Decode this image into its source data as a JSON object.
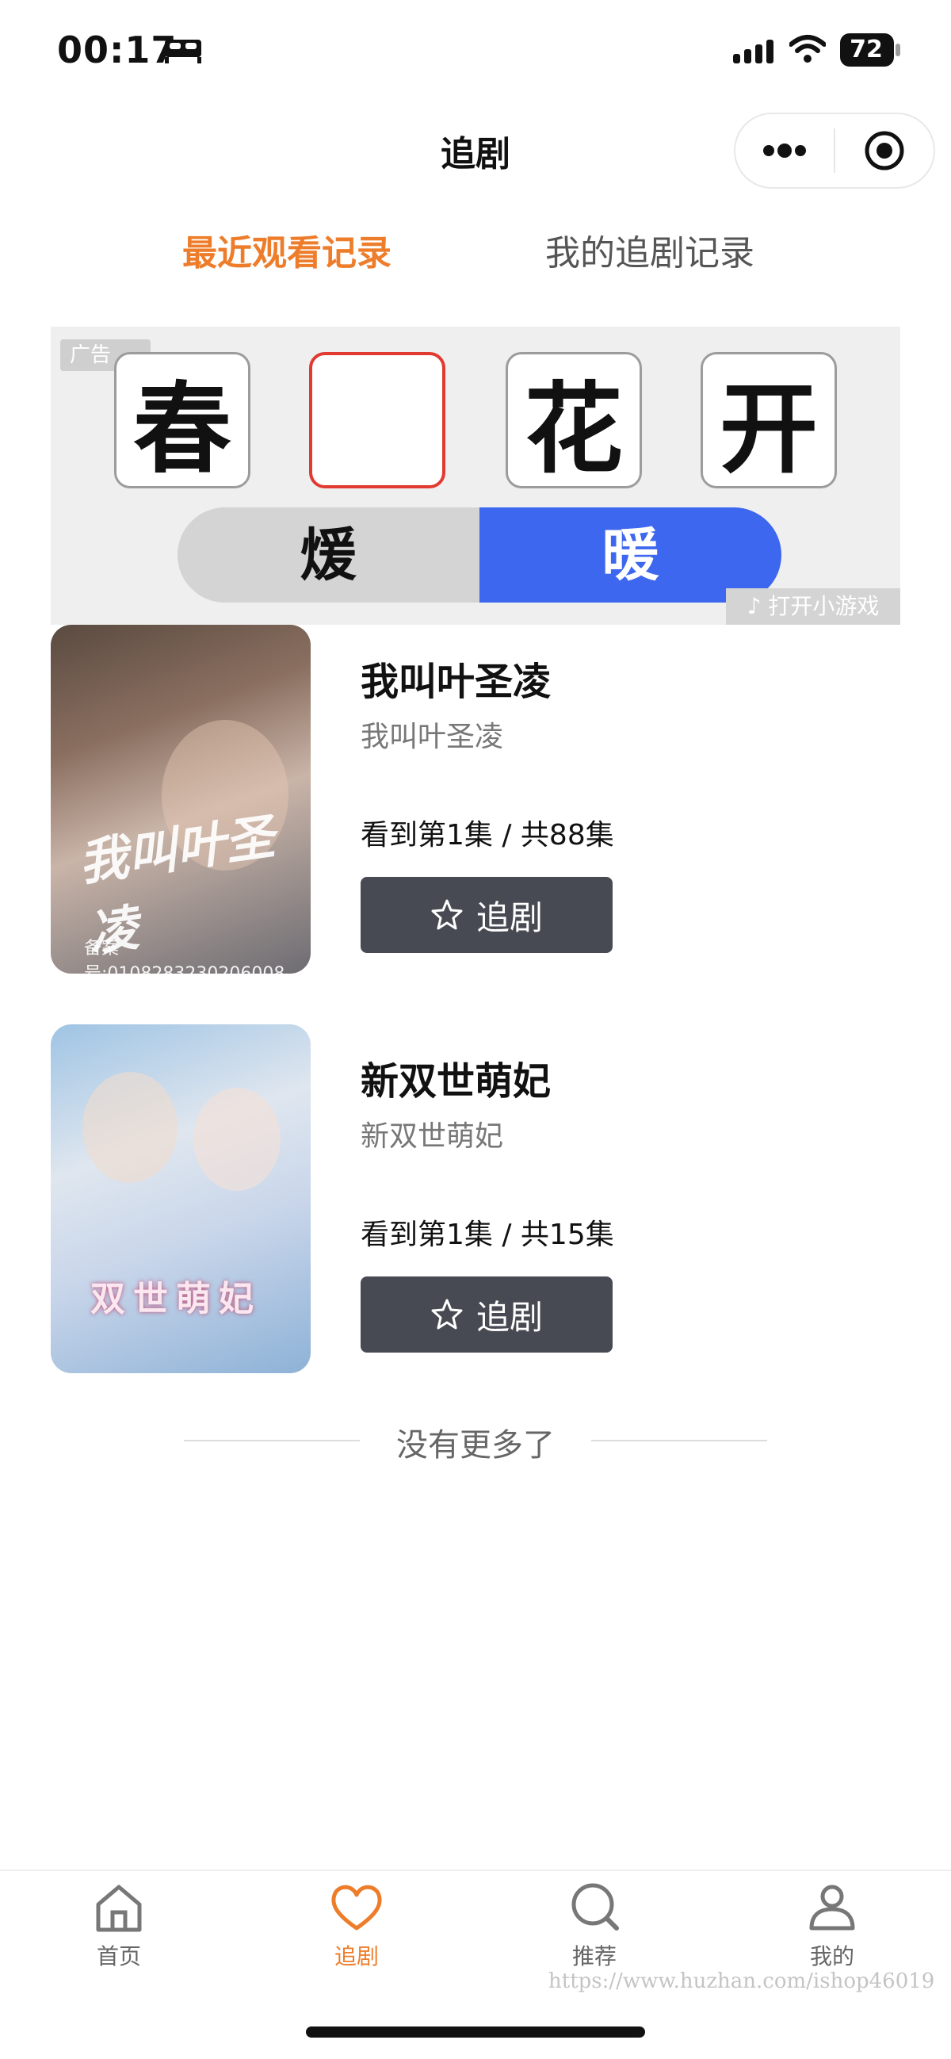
{
  "status_bar": {
    "time": "00:17",
    "battery": "72"
  },
  "nav": {
    "title": "追剧"
  },
  "tabs": {
    "recent": "最近观看记录",
    "mine": "我的追剧记录"
  },
  "ad": {
    "tag": "广告",
    "chars": [
      "春",
      "",
      "花",
      "开"
    ],
    "choices": [
      "煖",
      "暖"
    ],
    "open_game": "打开小游戏"
  },
  "dramas": [
    {
      "title": "我叫叶圣凌",
      "subtitle": "我叫叶圣凌",
      "progress": "看到第1集 / 共88集",
      "follow_label": "追剧",
      "poster_text": "我叫叶圣凌",
      "poster_code": "备案号:0108283230206008"
    },
    {
      "title": "新双世萌妃",
      "subtitle": "新双世萌妃",
      "progress": "看到第1集 / 共15集",
      "follow_label": "追剧",
      "poster_text": "双世萌妃"
    }
  ],
  "end_text": "没有更多了",
  "tabbar": {
    "items": [
      {
        "label": "首页",
        "icon": "home-icon",
        "active": false
      },
      {
        "label": "追剧",
        "icon": "heart-icon",
        "active": true
      },
      {
        "label": "推荐",
        "icon": "search-icon",
        "active": false
      },
      {
        "label": "我的",
        "icon": "user-icon",
        "active": false
      }
    ]
  },
  "watermark": "https://www.huzhan.com/ishop46019",
  "colors": {
    "accent": "#ee7d2b",
    "button": "#474a52",
    "ad_blue": "#3d67ee",
    "ad_red": "#e03a31"
  }
}
